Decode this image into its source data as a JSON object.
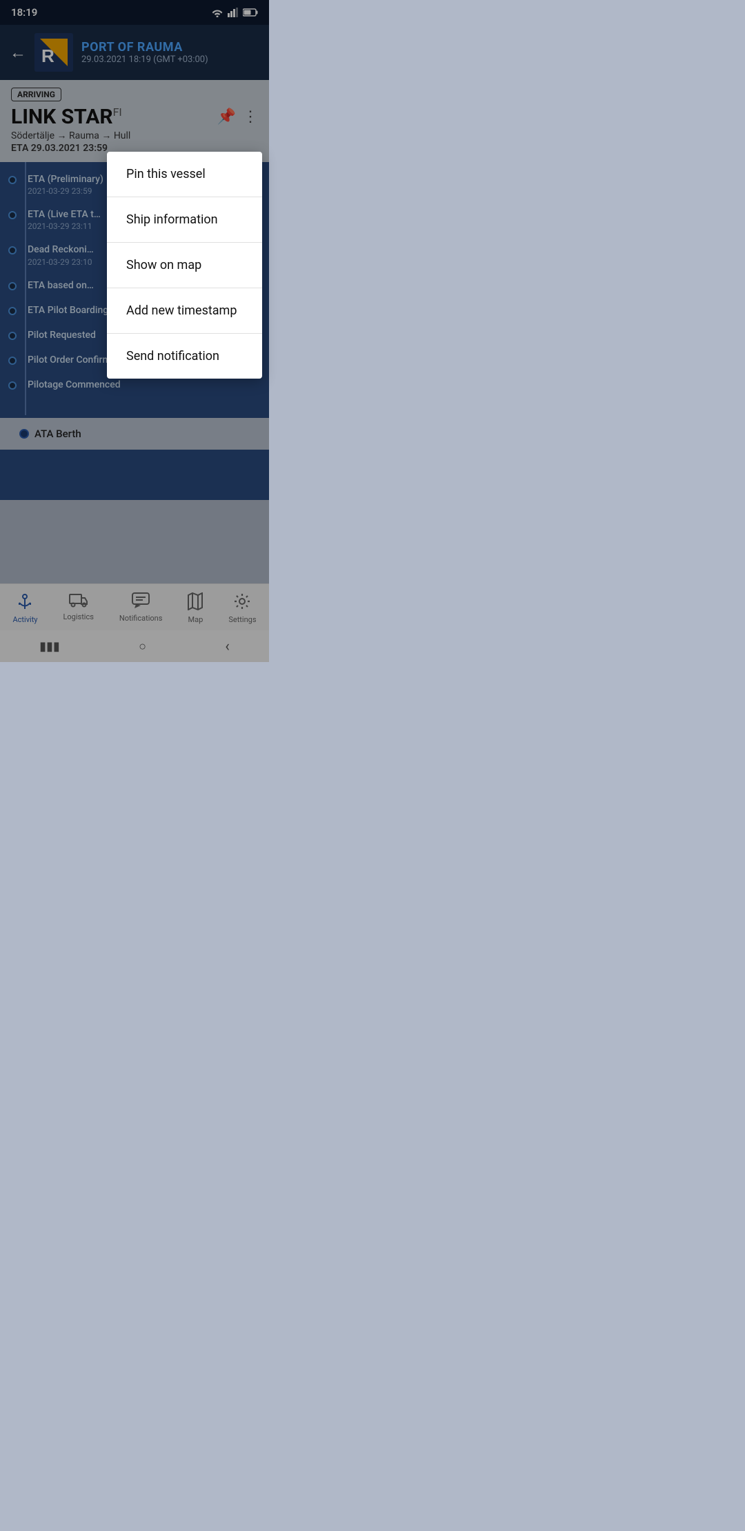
{
  "statusBar": {
    "time": "18:19"
  },
  "header": {
    "portName": "PORT OF RAUMA",
    "datetime": "29.03.2021 18:19 (GMT +03:00)",
    "backLabel": "back"
  },
  "vessel": {
    "badge": "ARRIVING",
    "name": "LINK STAR",
    "flag": "FI",
    "route": "Södertälje → Rauma → Hull",
    "eta": "ETA 29.03.2021 23:59"
  },
  "timeline": {
    "items": [
      {
        "label": "ETA (Preliminary)",
        "date": "2021-03-29 23:59"
      },
      {
        "label": "ETA (Live ETA t…",
        "date": "2021-03-29 23:11"
      },
      {
        "label": "Dead Reckoni…",
        "date": "2021-03-29 23:10"
      },
      {
        "label": "ETA based on…",
        "date": ""
      },
      {
        "label": "ETA Pilot Boarding Confirmed by Ship",
        "date": ""
      },
      {
        "label": "Pilot Requested",
        "date": ""
      },
      {
        "label": "Pilot Order Confirmed by Ship",
        "date": ""
      },
      {
        "label": "Pilotage Commenced",
        "date": ""
      }
    ],
    "ataBerth": "ATA Berth"
  },
  "contextMenu": {
    "items": [
      {
        "id": "pin-vessel",
        "label": "Pin this vessel"
      },
      {
        "id": "ship-info",
        "label": "Ship information"
      },
      {
        "id": "show-map",
        "label": "Show on map"
      },
      {
        "id": "add-timestamp",
        "label": "Add new timestamp"
      },
      {
        "id": "send-notification",
        "label": "Send notification"
      }
    ]
  },
  "bottomNav": {
    "items": [
      {
        "id": "activity",
        "label": "Activity",
        "icon": "⚓",
        "active": true
      },
      {
        "id": "logistics",
        "label": "Logistics",
        "icon": "🚚",
        "active": false
      },
      {
        "id": "notifications",
        "label": "Notifications",
        "icon": "💬",
        "active": false
      },
      {
        "id": "map",
        "label": "Map",
        "icon": "🗺",
        "active": false
      },
      {
        "id": "settings",
        "label": "Settings",
        "icon": "⚙",
        "active": false
      }
    ]
  },
  "androidNav": {
    "back": "‹",
    "home": "○",
    "recents": "▮▮▮"
  }
}
